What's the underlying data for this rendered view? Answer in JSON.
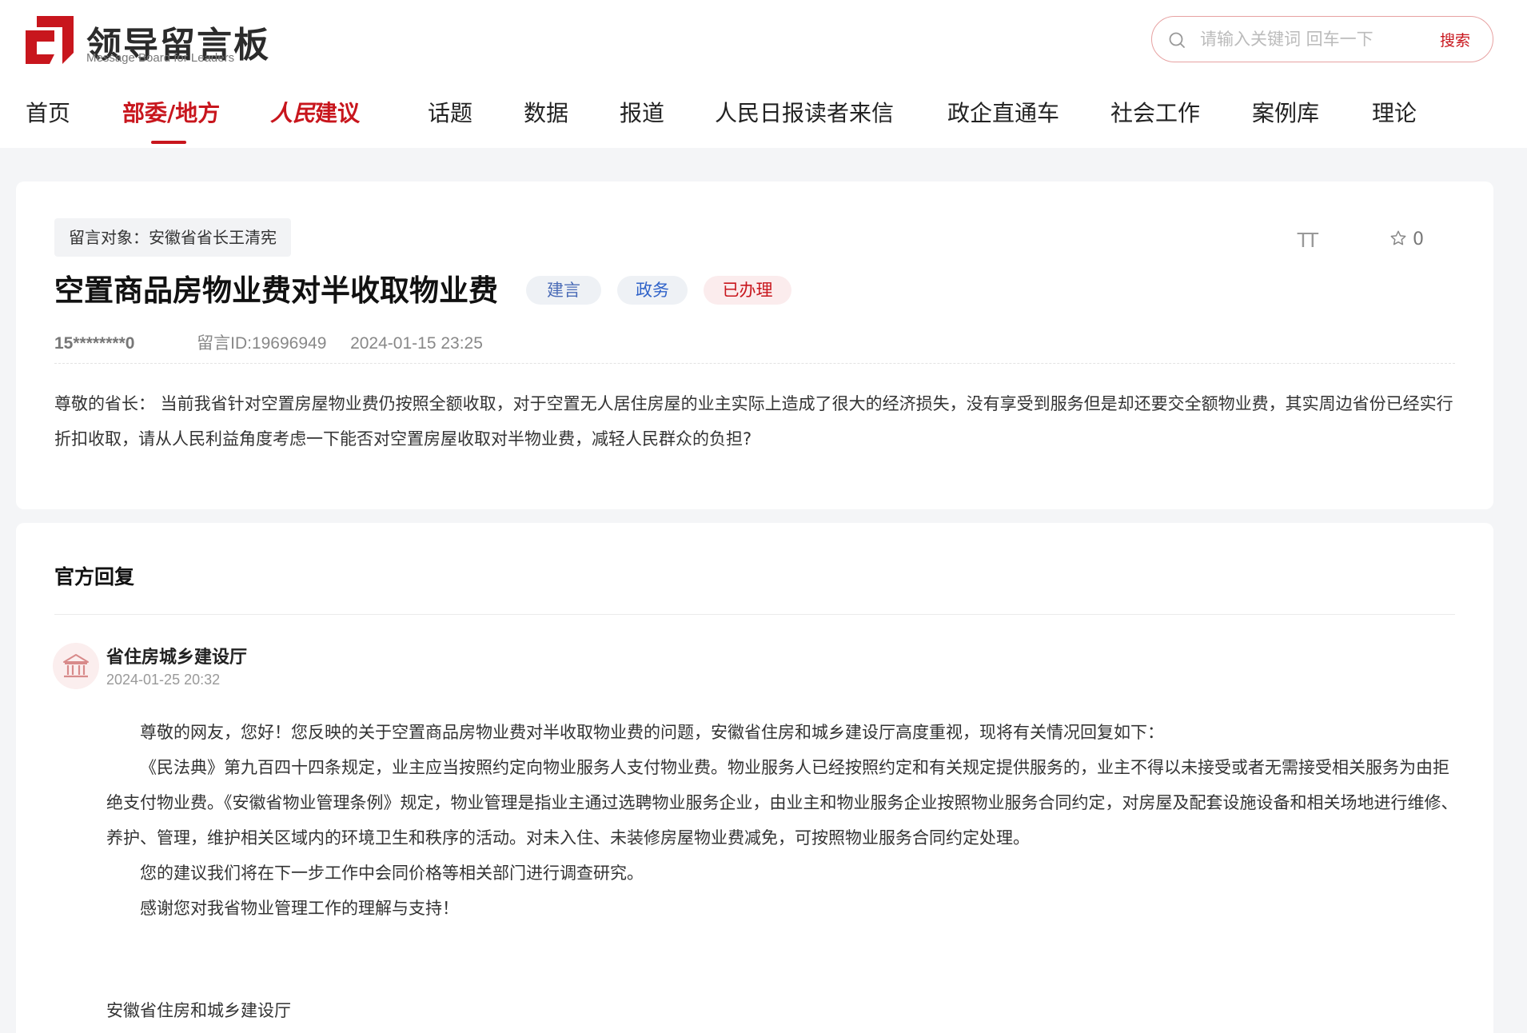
{
  "brand": {
    "title": "领导留言板",
    "subtitle": "Message Board for Leaders"
  },
  "search": {
    "placeholder": "请输入关键词 回车一下",
    "button_label": "搜索"
  },
  "nav": {
    "items": [
      {
        "label": "首页"
      },
      {
        "label": "部委/地方",
        "active": true
      },
      {
        "label_brand": "人民",
        "label_rest": "建议"
      },
      {
        "label": "话题"
      },
      {
        "label": "数据"
      },
      {
        "label": "报道"
      },
      {
        "label": "人民日报读者来信"
      },
      {
        "label": "政企直通车"
      },
      {
        "label": "社会工作"
      },
      {
        "label": "案例库"
      },
      {
        "label": "理论"
      }
    ]
  },
  "message": {
    "target": "留言对象：安徽省省长王清宪",
    "title": "空置商品房物业费对半收取物业费",
    "tags": [
      "建言",
      "政务",
      "已办理"
    ],
    "favorite_count": "0",
    "fontsize_glyph": "TT",
    "user": "15********0",
    "id_text": "留言ID:19696949",
    "datetime": "2024-01-15 23:25",
    "content": "尊敬的省长：  当前我省针对空置房屋物业费仍按照全额收取，对于空置无人居住房屋的业主实际上造成了很大的经济损失，没有享受到服务但是却还要交全额物业费，其实周边省份已经实行折扣收取，请从人民利益角度考虑一下能否对空置房屋收取对半物业费，减轻人民群众的负担?"
  },
  "reply": {
    "heading": "官方回复",
    "org": "省住房城乡建设厅",
    "datetime": "2024-01-25 20:32",
    "paragraphs": [
      "尊敬的网友，您好！您反映的关于空置商品房物业费对半收取物业费的问题，安徽省住房和城乡建设厅高度重视，现将有关情况回复如下：",
      "《民法典》第九百四十四条规定，业主应当按照约定向物业服务人支付物业费。物业服务人已经按照约定和有关规定提供服务的，业主不得以未接受或者无需接受相关服务为由拒绝支付物业费。《安徽省物业管理条例》规定，物业管理是指业主通过选聘物业服务企业，由业主和物业服务企业按照物业服务合同约定，对房屋及配套设施设备和相关场地进行维修、养护、管理，维护相关区域内的环境卫生和秩序的活动。对未入住、未装修房屋物业费减免，可按照物业服务合同约定处理。",
      "您的建议我们将在下一步工作中会同价格等相关部门进行调查研究。",
      "感谢您对我省物业管理工作的理解与支持！"
    ],
    "signature": "安徽省住房和城乡建设厅"
  },
  "colors": {
    "accent": "#c8161d",
    "background": "#f4f5f7"
  }
}
